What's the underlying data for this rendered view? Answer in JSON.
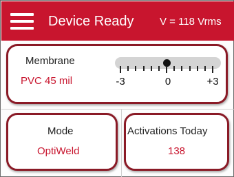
{
  "header": {
    "title": "Device Ready",
    "voltage": "V = 118 Vrms",
    "bar_color": "#c8152e"
  },
  "membrane": {
    "label": "Membrane",
    "value": "PVC 45 mil",
    "slider": {
      "min": -3,
      "max": 3,
      "value": 0,
      "min_label": "-3",
      "mid_label": "0",
      "max_label": "+3"
    }
  },
  "mode": {
    "label": "Mode",
    "value": "OptiWeld"
  },
  "activations": {
    "label": "Activations Today",
    "value": "138"
  },
  "colors": {
    "accent": "#c8152e",
    "card_border": "#8a1a26"
  },
  "icons": {
    "menu": "hamburger-menu-icon"
  }
}
